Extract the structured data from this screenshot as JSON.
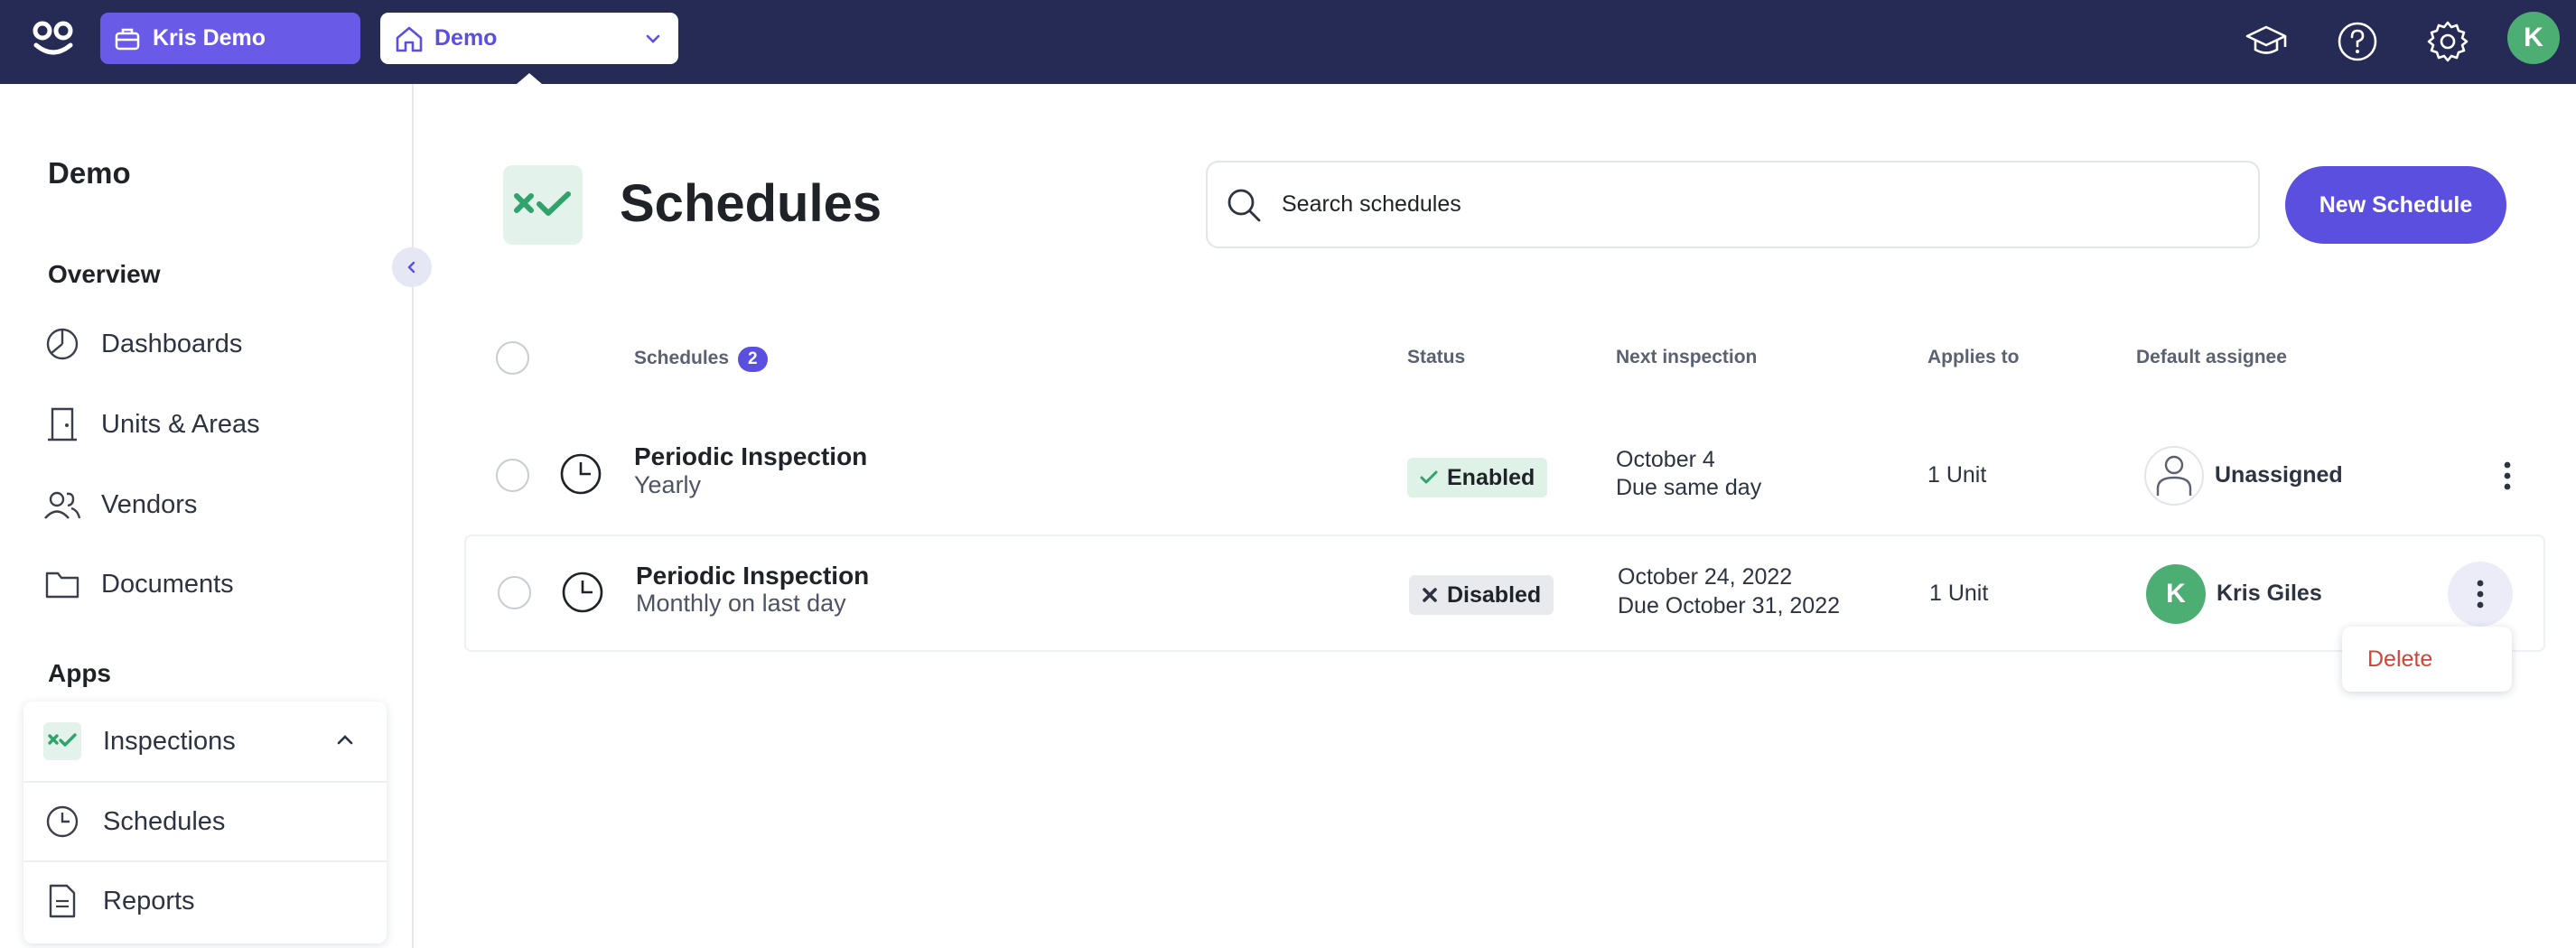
{
  "topbar": {
    "org_label": "Kris Demo",
    "property_label": "Demo",
    "avatar_initial": "K",
    "icons": [
      "graduation-cap-icon",
      "help-icon",
      "gear-icon"
    ]
  },
  "sidebar": {
    "title": "Demo",
    "overview_label": "Overview",
    "items": [
      {
        "label": "Dashboards",
        "icon": "pie-chart-icon"
      },
      {
        "label": "Units & Areas",
        "icon": "door-icon"
      },
      {
        "label": "Vendors",
        "icon": "users-icon"
      },
      {
        "label": "Documents",
        "icon": "folder-icon"
      }
    ],
    "apps_label": "Apps",
    "apps": [
      {
        "label": "Inspections",
        "icon": "inspections-icon"
      },
      {
        "label": "Schedules",
        "icon": "clock-icon"
      },
      {
        "label": "Reports",
        "icon": "document-icon"
      }
    ]
  },
  "page": {
    "title": "Schedules",
    "search_placeholder": "Search schedules",
    "new_button": "New Schedule"
  },
  "table": {
    "headers": {
      "schedules": "Schedules",
      "count": "2",
      "status": "Status",
      "next_inspection": "Next inspection",
      "applies_to": "Applies to",
      "default_assignee": "Default assignee"
    },
    "rows": [
      {
        "title": "Periodic Inspection",
        "frequency": "Yearly",
        "status": "Enabled",
        "next_date": "October 4",
        "due": "Due same day",
        "applies_to": "1 Unit",
        "assignee": "Unassigned",
        "assignee_initial": ""
      },
      {
        "title": "Periodic Inspection",
        "frequency": "Monthly on last day",
        "status": "Disabled",
        "next_date": "October 24, 2022",
        "due": "Due October 31, 2022",
        "applies_to": "1 Unit",
        "assignee": "Kris Giles",
        "assignee_initial": "K"
      }
    ]
  },
  "context_menu": {
    "delete_label": "Delete"
  },
  "colors": {
    "topbar": "#252b55",
    "accent": "#5b4fe0",
    "enabled_bg": "#dff2e8",
    "disabled_bg": "#e9eaee",
    "danger": "#d0443a",
    "avatar_green": "#4dae74"
  }
}
